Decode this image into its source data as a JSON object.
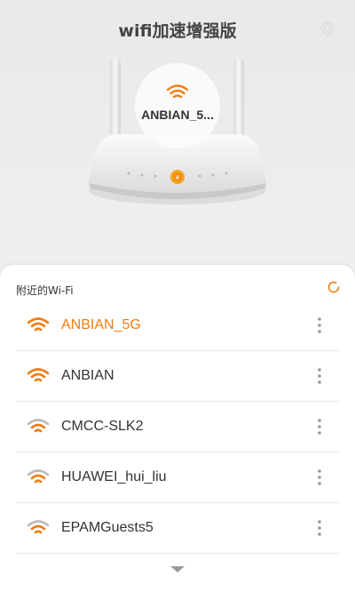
{
  "app": {
    "title": "wifi加速增强版"
  },
  "current": {
    "ssid": "ANBIAN_5..."
  },
  "nearby": {
    "header": "附近的Wi-Fi",
    "networks": [
      {
        "ssid": "ANBIAN_5G",
        "active": true,
        "signal": "strong"
      },
      {
        "ssid": "ANBIAN",
        "active": false,
        "signal": "strong"
      },
      {
        "ssid": "CMCC-SLK2",
        "active": false,
        "signal": "medium"
      },
      {
        "ssid": "HUAWEI_hui_liu",
        "active": false,
        "signal": "medium"
      },
      {
        "ssid": "EPAMGuests5",
        "active": false,
        "signal": "medium"
      }
    ]
  },
  "colors": {
    "accent": "#f07c10",
    "text": "#333333",
    "muted": "#bbbbbb"
  },
  "icons": {
    "settings": "gear-icon",
    "refresh": "refresh-icon",
    "wifi": "wifi-icon",
    "more": "more-vertical-icon",
    "expand": "chevron-down-icon"
  }
}
